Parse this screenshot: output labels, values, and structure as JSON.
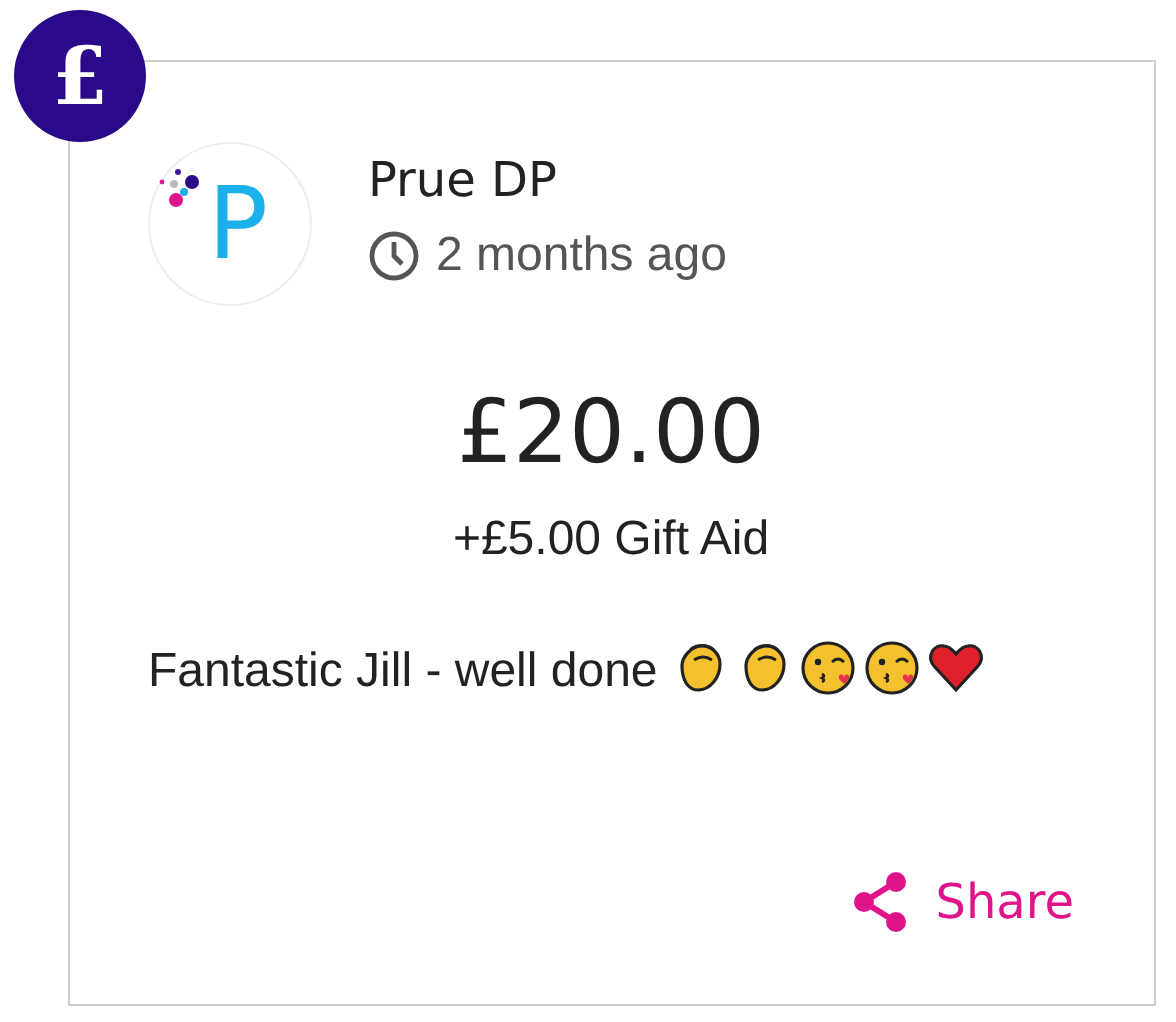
{
  "badge": {
    "symbol": "£"
  },
  "donor": {
    "avatar_letter": "P",
    "name": "Prue DP",
    "time": "2 months ago"
  },
  "amount": "£20.00",
  "gift_aid": "+£5.00 Gift Aid",
  "message": {
    "text": "Fantastic Jill - well done",
    "emojis": [
      {
        "kind": "clap"
      },
      {
        "kind": "clap"
      },
      {
        "kind": "kiss"
      },
      {
        "kind": "kiss"
      },
      {
        "kind": "heart"
      }
    ]
  },
  "share": {
    "label": "Share"
  }
}
